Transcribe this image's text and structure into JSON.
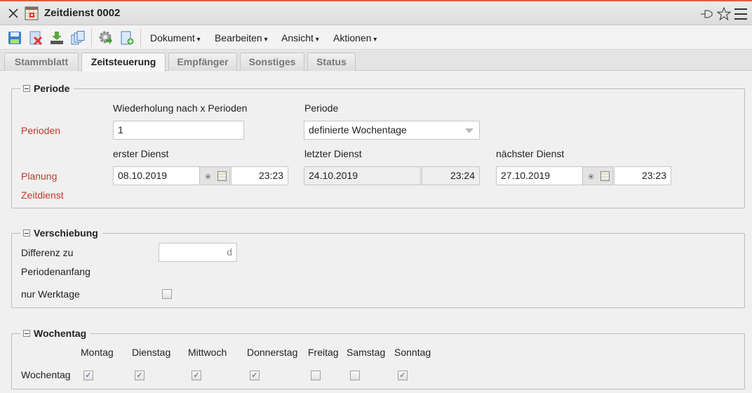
{
  "window": {
    "title": "Zeitdienst 0002"
  },
  "menus": [
    "Dokument",
    "Bearbeiten",
    "Ansicht",
    "Aktionen"
  ],
  "tabs": [
    "Stammblatt",
    "Zeitsteuerung",
    "Empfänger",
    "Sonstiges",
    "Status"
  ],
  "periode": {
    "legend": "Periode",
    "wiederholung_label": "Wiederholung nach x Perioden",
    "periode_label": "Periode",
    "perioden_label": "Perioden",
    "wiederholung_value": "1",
    "periode_value": "definierte Wochentage",
    "erster_label": "erster Dienst",
    "letzter_label": "letzter Dienst",
    "naechster_label": "nächster Dienst",
    "planung_label": "Planung",
    "zeitdienst_label": "Zeitdienst",
    "erster_date": "08.10.2019",
    "erster_time": "23:23",
    "letzter_date": "24.10.2019",
    "letzter_time": "23:24",
    "naechster_date": "27.10.2019",
    "naechster_time": "23:23"
  },
  "verschiebung": {
    "legend": "Verschiebung",
    "differenz_label_1": "Differenz zu",
    "differenz_label_2": "Periodenanfang",
    "differenz_unit": "d",
    "werktage_label": "nur Werktage",
    "werktage_checked": false
  },
  "wochentag": {
    "legend": "Wochentag",
    "row_label": "Wochentag",
    "days": [
      {
        "label": "Montag",
        "checked": true
      },
      {
        "label": "Dienstag",
        "checked": true
      },
      {
        "label": "Mittwoch",
        "checked": true
      },
      {
        "label": "Donnerstag",
        "checked": true
      },
      {
        "label": "Freitag",
        "checked": false
      },
      {
        "label": "Samstag",
        "checked": false
      },
      {
        "label": "Sonntag",
        "checked": true
      }
    ]
  }
}
